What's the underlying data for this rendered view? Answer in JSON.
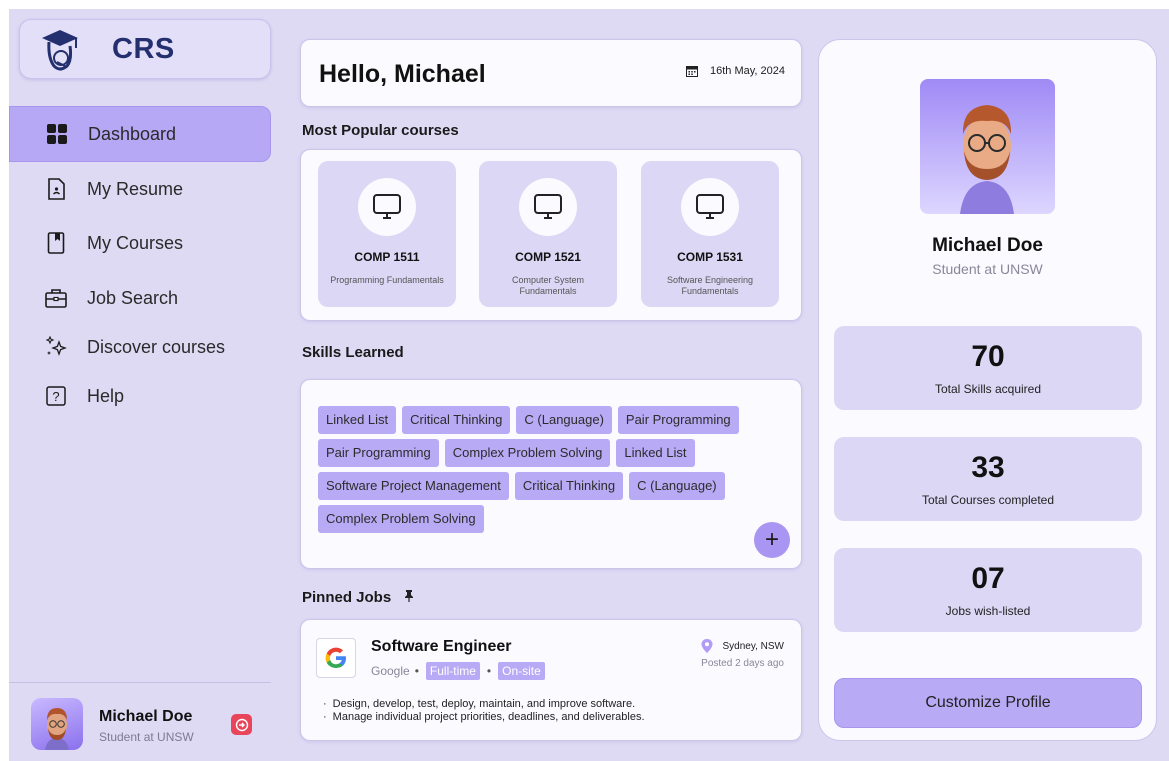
{
  "app": {
    "logo_text": "CRS"
  },
  "sidebar": {
    "items": [
      {
        "label": "Dashboard",
        "icon": "grid-icon",
        "active": true
      },
      {
        "label": "My Resume",
        "icon": "document-icon"
      },
      {
        "label": "My Courses",
        "icon": "bookmark-icon"
      },
      {
        "label": "Job Search",
        "icon": "briefcase-icon"
      },
      {
        "label": "Discover courses",
        "icon": "sparkles-icon"
      },
      {
        "label": "Help",
        "icon": "question-icon"
      }
    ],
    "user": {
      "name": "Michael Doe",
      "role": "Student at UNSW"
    }
  },
  "header": {
    "greeting": "Hello, Michael",
    "date": "16th May, 2024"
  },
  "popular": {
    "title": "Most Popular courses",
    "courses": [
      {
        "code": "COMP 1511",
        "name": "Programming Fundamentals"
      },
      {
        "code": "COMP 1521",
        "name": "Computer System Fundamentals"
      },
      {
        "code": "COMP 1531",
        "name": "Software Engineering Fundamentals"
      }
    ]
  },
  "skills": {
    "title": "Skills Learned",
    "tags": [
      "Linked List",
      "Critical Thinking",
      "C (Language)",
      "Pair Programming",
      "Pair Programming",
      "Complex Problem Solving",
      "Linked List",
      "Software Project Management",
      "Critical Thinking",
      "C (Language)",
      "Complex Problem Solving"
    ],
    "add_label": "+"
  },
  "jobs": {
    "title": "Pinned Jobs",
    "pinned": [
      {
        "title": "Software Engineer",
        "company": "Google",
        "type": "Full-time",
        "mode": "On-site",
        "location": "Sydney, NSW",
        "posted": "Posted 2 days ago",
        "logo_letter": "G",
        "bullets": [
          "Design, develop, test, deploy, maintain, and improve software.",
          "Manage individual project priorities, deadlines, and deliverables."
        ]
      }
    ]
  },
  "profile": {
    "name": "Michael Doe",
    "role": "Student at UNSW",
    "stats": [
      {
        "value": "70",
        "label": "Total Skills acquired"
      },
      {
        "value": "33",
        "label": "Total Courses completed"
      },
      {
        "value": "07",
        "label": "Jobs wish-listed"
      }
    ],
    "customize_label": "Customize Profile"
  },
  "colors": {
    "accent": "#b8aaf4",
    "panel": "#dedaf4",
    "logout": "#e8445a",
    "brand": "#232f6e"
  }
}
